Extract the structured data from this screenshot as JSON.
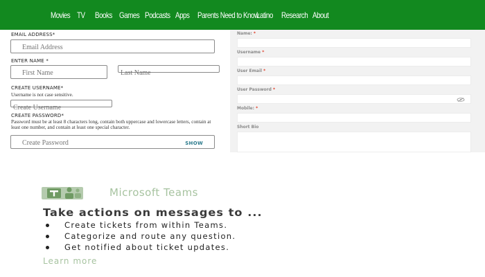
{
  "nav": {
    "items": [
      {
        "label": "Movies"
      },
      {
        "label": "TV"
      },
      {
        "label": "Books"
      },
      {
        "label": "Games"
      },
      {
        "label": "Podcasts"
      },
      {
        "label": "Apps"
      },
      {
        "label": "Parents Need to Know"
      },
      {
        "label": "Latino"
      },
      {
        "label": "Research"
      },
      {
        "label": "About"
      }
    ]
  },
  "signup": {
    "email_label": "EMAIL ADDRESS*",
    "email_placeholder": "Email Address",
    "name_label": "ENTER NAME *",
    "first_placeholder": "First Name",
    "last_placeholder": "Last Name",
    "username_label": "CREATE USERNAME*",
    "username_help": "Username is not case sensitive.",
    "username_placeholder": "Create Username",
    "password_label": "CREATE PASSWORD*",
    "password_help": "Password must be at least 8 characters long, contain both uppercase and lowercase letters, contain at least one number, and contain at least one special character.",
    "password_placeholder": "Create Password",
    "show_label": "SHOW"
  },
  "profile": {
    "fields": [
      {
        "label": "Name:",
        "req": "*"
      },
      {
        "label": "Username",
        "req": "*"
      },
      {
        "label": "User Email",
        "req": "*"
      },
      {
        "label": "User Password",
        "req": "*"
      },
      {
        "label": "Mobile:",
        "req": "*"
      },
      {
        "label": "Short Bio",
        "req": ""
      }
    ]
  },
  "teams": {
    "logo_icon": "microsoft-teams-logo",
    "title": "Microsoft Teams",
    "headline": "Take actions on messages to ...",
    "bullets": [
      "Create tickets from within Teams.",
      "Categorize and route any question.",
      "Get notified about ticket updates."
    ],
    "learn_more": "Learn more",
    "colors": {
      "brand": "#a7c3a0",
      "nav_green": "#12891f"
    }
  }
}
